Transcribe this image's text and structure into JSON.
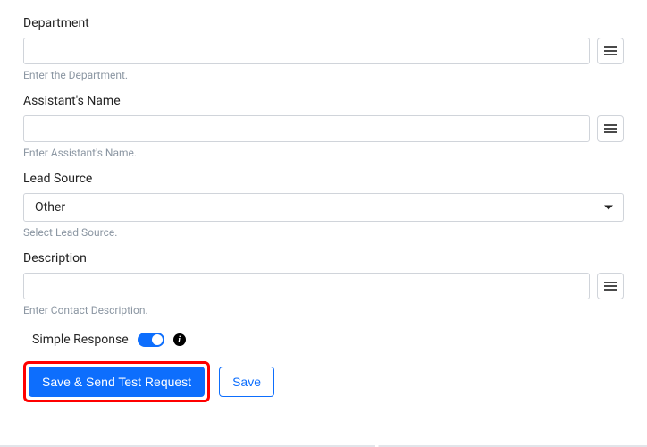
{
  "fields": {
    "department": {
      "label": "Department",
      "value": "",
      "helper": "Enter the Department."
    },
    "assistant": {
      "label": "Assistant's Name",
      "value": "",
      "helper": "Enter Assistant's Name."
    },
    "lead_source": {
      "label": "Lead Source",
      "selected": "Other",
      "helper": "Select Lead Source."
    },
    "description": {
      "label": "Description",
      "value": "",
      "helper": "Enter Contact Description."
    }
  },
  "simple_response": {
    "label": "Simple Response",
    "on": true
  },
  "buttons": {
    "save_send": "Save & Send Test Request",
    "save": "Save"
  }
}
